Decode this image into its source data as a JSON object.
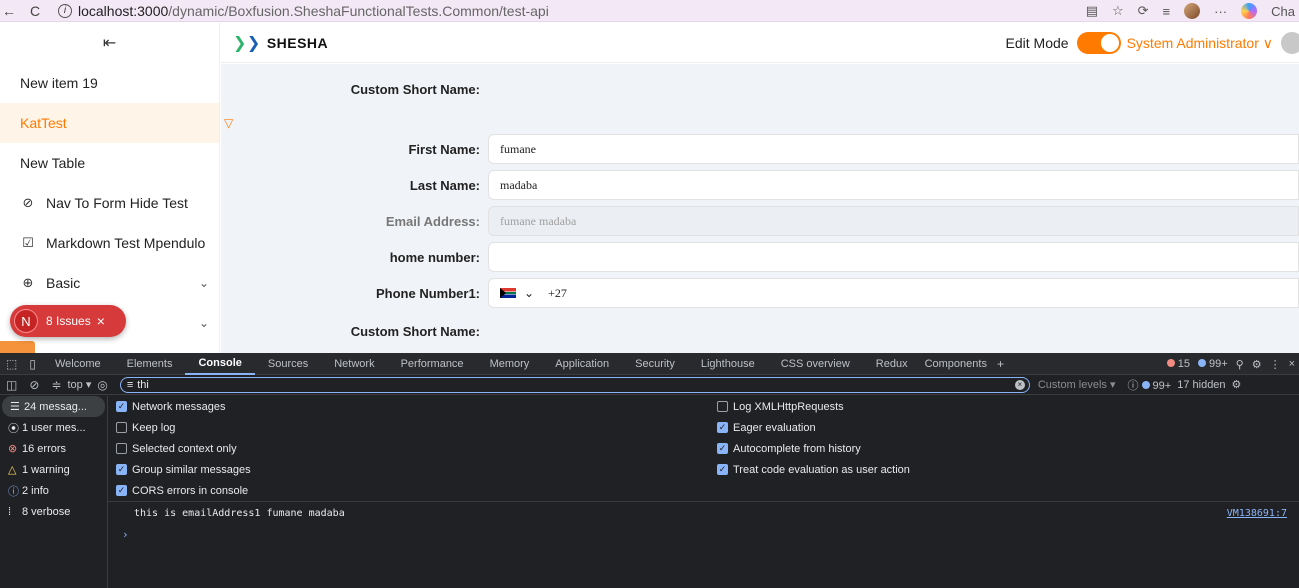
{
  "browser": {
    "url_host": "localhost:3000",
    "url_path": "/dynamic/Boxfusion.SheshaFunctionalTests.Common/test-api",
    "back": "←",
    "reload": "C",
    "profile_label": "Cha"
  },
  "sidebar": {
    "items": [
      {
        "label": "New item 19"
      },
      {
        "label": "KatTest"
      },
      {
        "label": "New Table"
      },
      {
        "label": "Nav To Form Hide Test"
      },
      {
        "label": "Markdown Test Mpendulo"
      },
      {
        "label": "Basic"
      },
      {
        "label": "st"
      }
    ]
  },
  "issues_badge": {
    "initial": "N",
    "text": "8 Issues",
    "close": "×"
  },
  "header": {
    "logo": "SHESHA",
    "edit_mode_label": "Edit Mode",
    "edit_mode_on": true,
    "user": "System Administrator",
    "accent": "#ff7a00"
  },
  "form": {
    "fields": [
      {
        "label": "Custom Short Name:",
        "value": "",
        "has_input": false
      },
      {
        "label": "First Name:",
        "value": "fumane",
        "has_input": true
      },
      {
        "label": "Last Name:",
        "value": "madaba",
        "has_input": true
      },
      {
        "label": "Email Address:",
        "value": "fumane madaba",
        "has_input": true,
        "disabled": true
      },
      {
        "label": "home number:",
        "value": "",
        "has_input": true
      },
      {
        "label": "Phone Number1:",
        "value": "+27",
        "has_input": true,
        "flag": "ZA"
      },
      {
        "label": "Custom Short Name:",
        "value": "",
        "has_input": false
      }
    ]
  },
  "devtools": {
    "tabs": [
      "Welcome",
      "Elements",
      "Console",
      "Sources",
      "Network",
      "Performance",
      "Memory",
      "Application",
      "Security",
      "Lighthouse",
      "CSS overview",
      "Redux",
      "Components"
    ],
    "active_tab": "Console",
    "error_count": "15",
    "message_count": "99+",
    "context": "top",
    "filter_value": "thi",
    "custom_levels": "Custom levels",
    "issues_count": "99+",
    "hidden_count": "17 hidden",
    "side_items": [
      {
        "label": "24 messag...",
        "icon": "list-icon"
      },
      {
        "label": "1 user mes...",
        "icon": "user-icon"
      },
      {
        "label": "16 errors",
        "icon": "error-icon"
      },
      {
        "label": "1 warning",
        "icon": "warning-icon"
      },
      {
        "label": "2 info",
        "icon": "info-icon"
      },
      {
        "label": "8 verbose",
        "icon": "verbose-icon"
      }
    ],
    "settings_left": [
      {
        "label": "Network messages",
        "checked": true
      },
      {
        "label": "Keep log",
        "checked": false
      },
      {
        "label": "Selected context only",
        "checked": false
      },
      {
        "label": "Group similar messages",
        "checked": true
      },
      {
        "label": "CORS errors in console",
        "checked": true
      }
    ],
    "settings_right": [
      {
        "label": "Log XMLHttpRequests",
        "checked": false
      },
      {
        "label": "Eager evaluation",
        "checked": true
      },
      {
        "label": "Autocomplete from history",
        "checked": true
      },
      {
        "label": "Treat code evaluation as user action",
        "checked": true
      }
    ],
    "log_message": "this is emailAddress1 fumane madaba",
    "log_source": "VM138691:7",
    "prompt": "›"
  }
}
